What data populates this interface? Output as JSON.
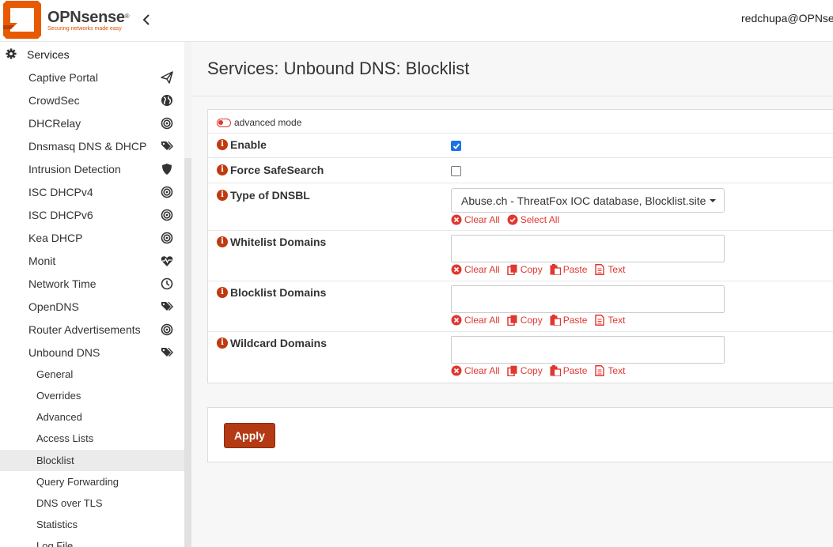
{
  "brand": {
    "name": "OPNsense",
    "reg": "®",
    "tagline": "Securing networks made easy",
    "accent": "#d94f00"
  },
  "header": {
    "user": "redchupa@OPNsense"
  },
  "sidebar": {
    "section": "Services",
    "items": [
      {
        "label": "Captive Portal",
        "icon": "paper-plane-icon"
      },
      {
        "label": "CrowdSec",
        "icon": "globe-icon"
      },
      {
        "label": "DHCRelay",
        "icon": "bullseye-icon"
      },
      {
        "label": "Dnsmasq DNS & DHCP",
        "icon": "tags-icon"
      },
      {
        "label": "Intrusion Detection",
        "icon": "shield-icon"
      },
      {
        "label": "ISC DHCPv4",
        "icon": "bullseye-icon"
      },
      {
        "label": "ISC DHCPv6",
        "icon": "bullseye-icon"
      },
      {
        "label": "Kea DHCP",
        "icon": "bullseye-icon"
      },
      {
        "label": "Monit",
        "icon": "heartbeat-icon"
      },
      {
        "label": "Network Time",
        "icon": "clock-icon"
      },
      {
        "label": "OpenDNS",
        "icon": "tags-icon"
      },
      {
        "label": "Router Advertisements",
        "icon": "bullseye-icon"
      },
      {
        "label": "Unbound DNS",
        "icon": "tags-icon"
      }
    ],
    "subitems": [
      {
        "label": "General"
      },
      {
        "label": "Overrides"
      },
      {
        "label": "Advanced"
      },
      {
        "label": "Access Lists"
      },
      {
        "label": "Blocklist"
      },
      {
        "label": "Query Forwarding"
      },
      {
        "label": "DNS over TLS"
      },
      {
        "label": "Statistics"
      },
      {
        "label": "Log File"
      }
    ]
  },
  "page": {
    "title": "Services: Unbound DNS: Blocklist"
  },
  "form": {
    "advanced_mode": "advanced mode",
    "enable": {
      "label": "Enable",
      "checked": true
    },
    "force_safesearch": {
      "label": "Force SafeSearch",
      "checked": false
    },
    "type_of_dnsbl": {
      "label": "Type of DNSBL",
      "selected": "Abuse.ch - ThreatFox IOC database, Blocklist.site Mal",
      "clear_all": "Clear All",
      "select_all": "Select All"
    },
    "whitelist": {
      "label": "Whitelist Domains",
      "value": ""
    },
    "blocklist": {
      "label": "Blocklist Domains",
      "value": ""
    },
    "wildcard": {
      "label": "Wildcard Domains",
      "value": ""
    },
    "actions": {
      "clear_all": "Clear All",
      "copy": "Copy",
      "paste": "Paste",
      "text": "Text"
    },
    "info_glyph": "i"
  },
  "footer": {
    "apply": "Apply"
  },
  "colors": {
    "action_red": "#e0372f",
    "apply_bg": "#b33a14",
    "active_item_bg": "#ebebeb"
  }
}
